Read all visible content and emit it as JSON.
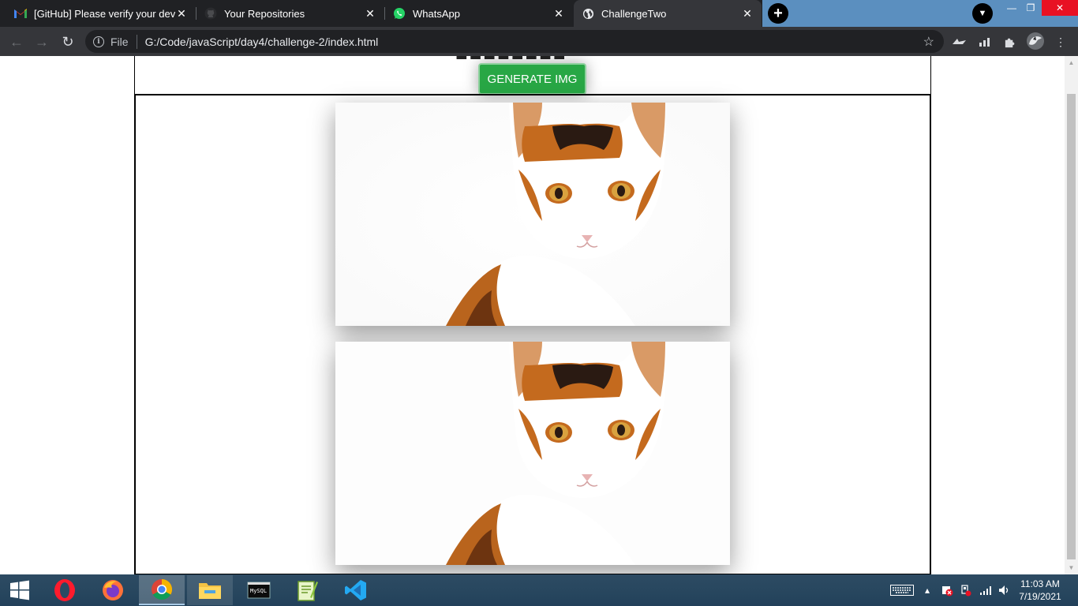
{
  "browser": {
    "tabs": [
      {
        "title": "[GitHub] Please verify your device",
        "favicon": "gmail-icon",
        "active": false
      },
      {
        "title": "Your Repositories",
        "favicon": "github-icon",
        "active": false
      },
      {
        "title": "WhatsApp",
        "favicon": "whatsapp-icon",
        "active": false
      },
      {
        "title": "ChallengeTwo",
        "favicon": "globe-icon",
        "active": true
      }
    ],
    "omnibox": {
      "scheme_chip": "File",
      "url": "G:/Code/javaScript/day4/challenge-2/index.html"
    }
  },
  "page": {
    "generate_button_label": "GENERATE IMG",
    "images": [
      {
        "alt": "cat"
      },
      {
        "alt": "cat"
      }
    ]
  },
  "taskbar": {
    "apps": [
      "opera",
      "firefox",
      "chrome",
      "file-explorer",
      "mysql",
      "notepad-plus-plus",
      "vscode"
    ],
    "active_app": "chrome"
  },
  "clock": {
    "time": "11:03 AM",
    "date": "7/19/2021"
  },
  "colors": {
    "button_green": "#28a745",
    "tab_strip": "#202124",
    "active_tab": "#35363a",
    "title_bar_right": "#5b8fbf",
    "close_red": "#e81123"
  }
}
